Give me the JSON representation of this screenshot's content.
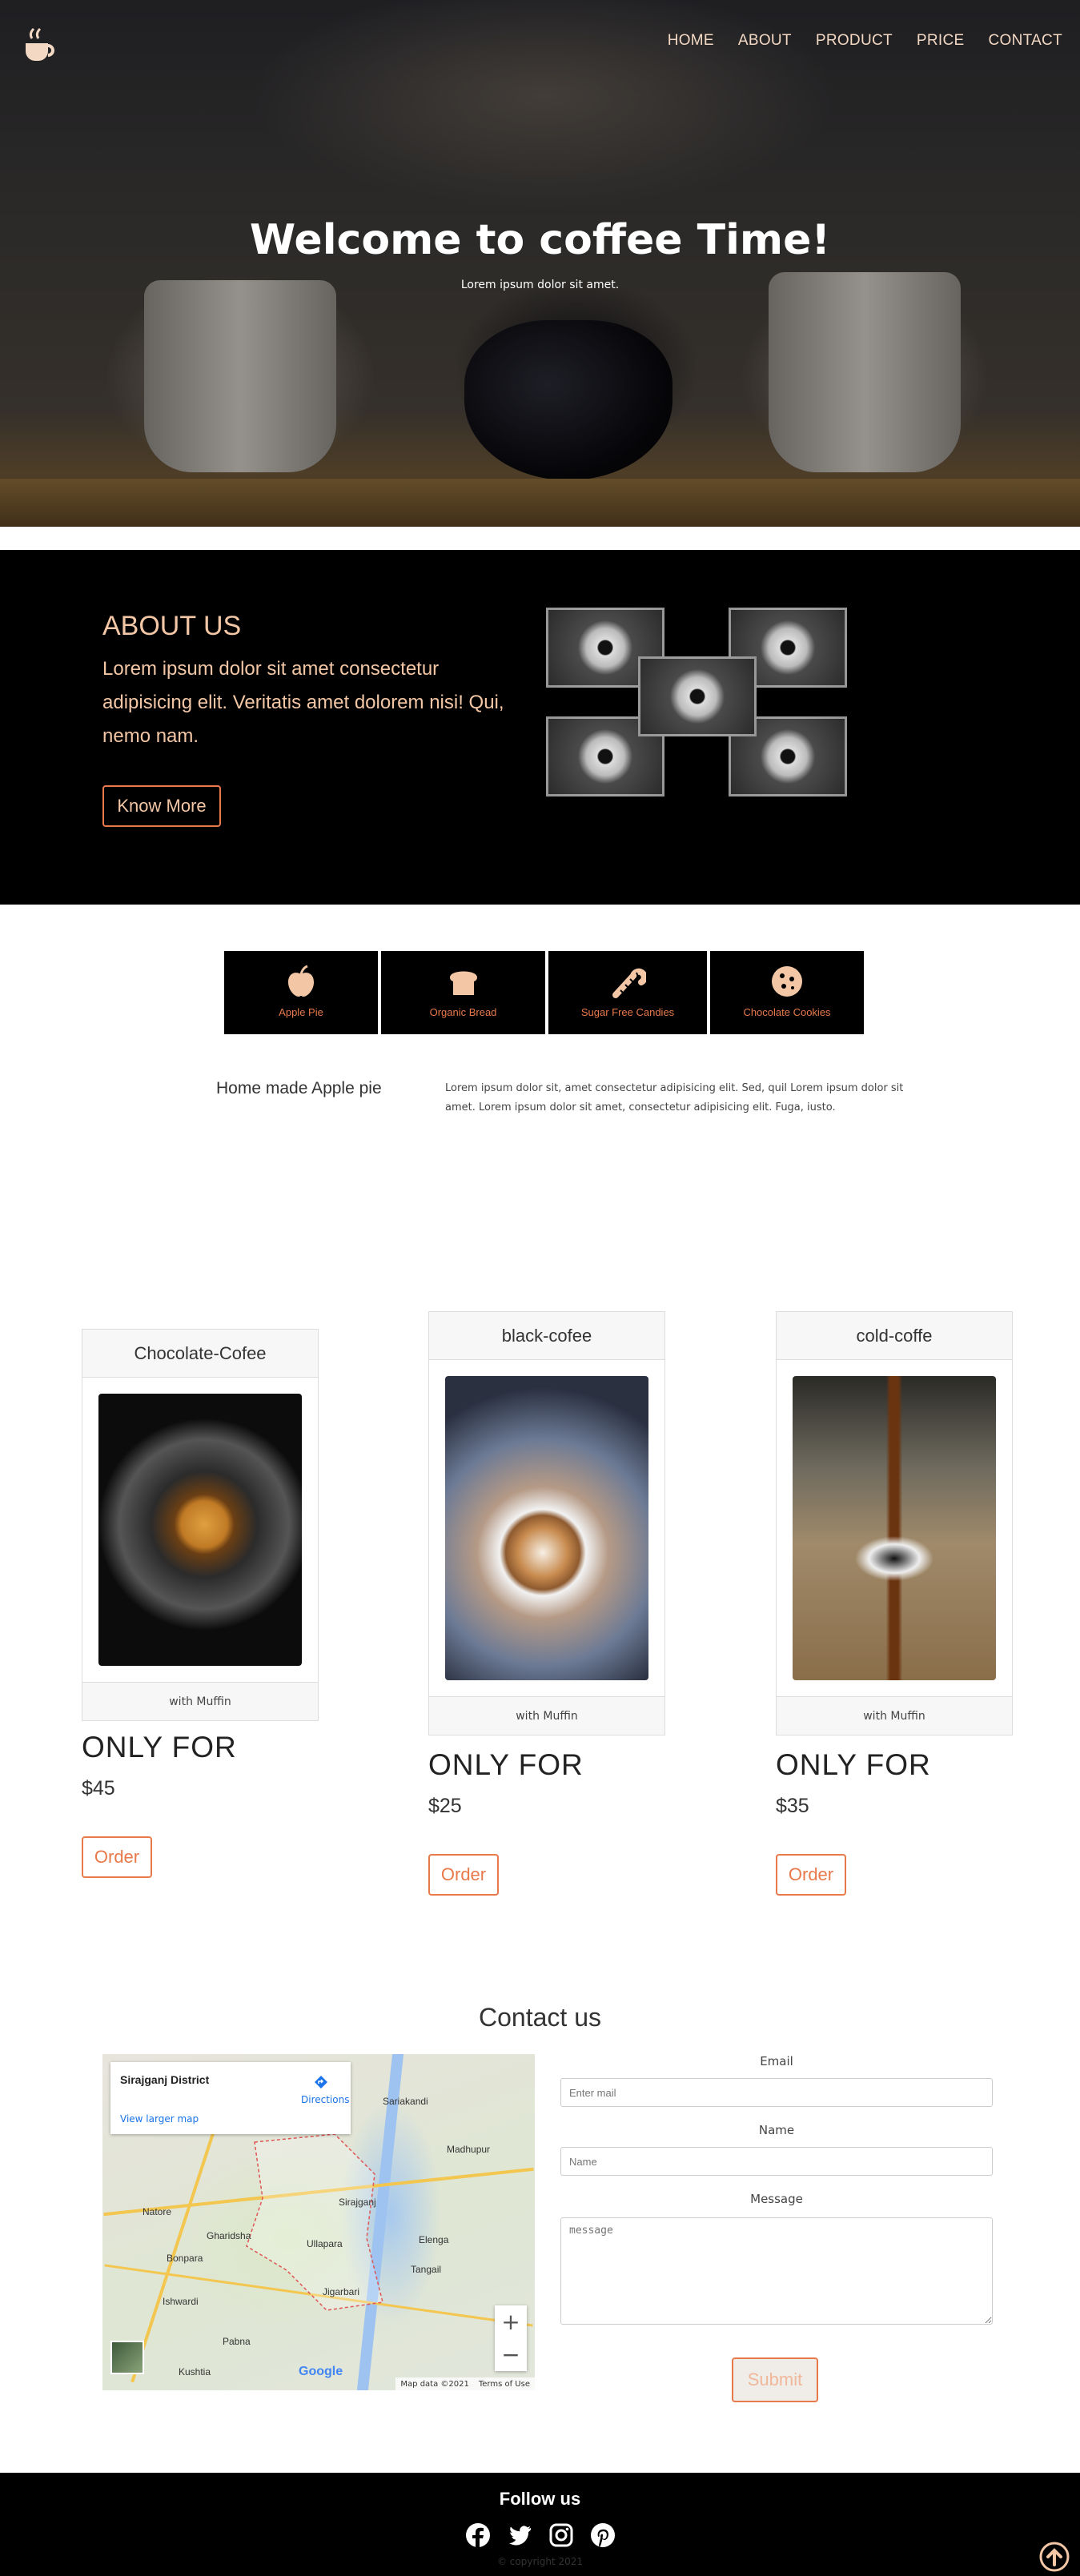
{
  "nav": {
    "items": [
      "HOME",
      "ABOUT",
      "PRODUCT",
      "PRICE",
      "CONTACT"
    ]
  },
  "hero": {
    "title": "Welcome to coffee Time!",
    "subtitle": "Lorem ipsum dolor sit amet."
  },
  "about": {
    "title": "ABOUT US",
    "text": "Lorem ipsum dolor sit amet consectetur adipisicing elit. Veritatis amet dolorem nisi! Qui, nemo nam.",
    "button": "Know More"
  },
  "tabs": [
    {
      "label": "Apple Pie",
      "icon": "apple-icon"
    },
    {
      "label": "Organic Bread",
      "icon": "bread-icon"
    },
    {
      "label": "Sugar Free Candies",
      "icon": "candy-cane-icon"
    },
    {
      "label": "Chocolate Cookies",
      "icon": "cookie-icon"
    }
  ],
  "tab_content": {
    "title": "Home made Apple pie",
    "text": "Lorem ipsum dolor sit, amet consectetur adipisicing elit. Sed, quil Lorem ipsum dolor sit amet. Lorem ipsum dolor sit amet, consectetur adipisicing elit. Fuga, iusto."
  },
  "products": [
    {
      "name": "Chocolate-Cofee",
      "footer": "with Muffin",
      "only_for": "ONLY FOR",
      "price": "$45",
      "button": "Order"
    },
    {
      "name": "black-cofee",
      "footer": "with Muffin",
      "only_for": "ONLY FOR",
      "price": "$25",
      "button": "Order"
    },
    {
      "name": "cold-coffe",
      "footer": "with Muffin",
      "only_for": "ONLY FOR",
      "price": "$35",
      "button": "Order"
    }
  ],
  "contact": {
    "title": "Contact us",
    "email_label": "Email",
    "email_placeholder": "Enter mail",
    "name_label": "Name",
    "name_placeholder": "Name",
    "message_label": "Message",
    "message_placeholder": "message",
    "submit": "Submit"
  },
  "map": {
    "place": "Sirajganj District",
    "directions": "Directions",
    "larger": "View larger map",
    "zoom_in": "+",
    "zoom_out": "−",
    "google": "Google",
    "data": "Map data ©2021",
    "terms": "Terms of Use",
    "labels": [
      "Natore",
      "Sirajganj",
      "Tangail",
      "Pabna",
      "Ullapara",
      "Bonpara",
      "Ishwardi",
      "Kushtia",
      "Sariakandi",
      "Madhupur",
      "Elenga",
      "Jigarbari",
      "Gharidsha"
    ]
  },
  "footer": {
    "title": "Follow us",
    "copyright": "© copyright 2021"
  },
  "colors": {
    "accent": "#e8794a",
    "peach": "#f3c7a6",
    "dark": "#000000"
  }
}
